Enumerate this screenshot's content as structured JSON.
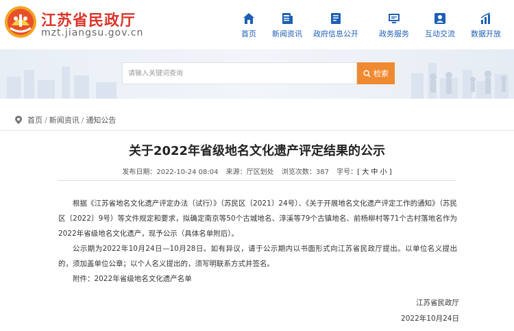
{
  "site": {
    "title": "江苏省民政厅",
    "domain": "mzt.jiangsu.gov.cn"
  },
  "nav": [
    {
      "label": "首页",
      "icon": "home-icon"
    },
    {
      "label": "新闻资讯",
      "icon": "news-icon"
    },
    {
      "label": "政府信息公开",
      "icon": "document-icon"
    },
    {
      "label": "政务服务",
      "icon": "monitor-icon"
    },
    {
      "label": "互动交流",
      "icon": "user-chat-icon"
    },
    {
      "label": "数据开放",
      "icon": "bar-chart-icon"
    }
  ],
  "search": {
    "placeholder": "请输入关键词查询",
    "button_label": "检索"
  },
  "breadcrumb": [
    "首页",
    "新闻资讯",
    "通知公告"
  ],
  "article": {
    "title": "关于2022年省级地名文化遗产评定结果的公示",
    "meta": {
      "publish_label": "发布日期：",
      "publish_value": "2022-10-24 08:04",
      "source_label": "来源：",
      "source_value": "厅区划处",
      "views_label": "浏览次数：",
      "views_value": "387",
      "size_label": "字号：",
      "size_value": "[ 大 中 小 ]"
    },
    "paragraphs": [
      "根据《江苏省地名文化遗产评定办法（试行）》（苏民区〔2021〕24号）、《关于开展地名文化遗产评定工作的通知》（苏民区〔2022〕9号）等文件规定和要求，拟确定南京等50个古城地名、淳溪等79个古镇地名、前杨柳村等71个古村落地名作为2022年省级地名文化遗产，现予公示（具体名单附后）。",
      "公示期为2022年10月24日—10月28日。如有异议，请于公示期内以书面形式向江苏省民政厅提出。以单位名义提出的，须加盖单位公章；以个人名义提出的，须写明联系方式并签名。",
      "附件：2022年省级地名文化遗产名单"
    ],
    "signature": "江苏省民政厅",
    "date": "2022年10月24日"
  },
  "colors": {
    "brand_red": "#d9362b",
    "nav_blue": "#1d5fb4",
    "search_orange": "#f08a31"
  }
}
